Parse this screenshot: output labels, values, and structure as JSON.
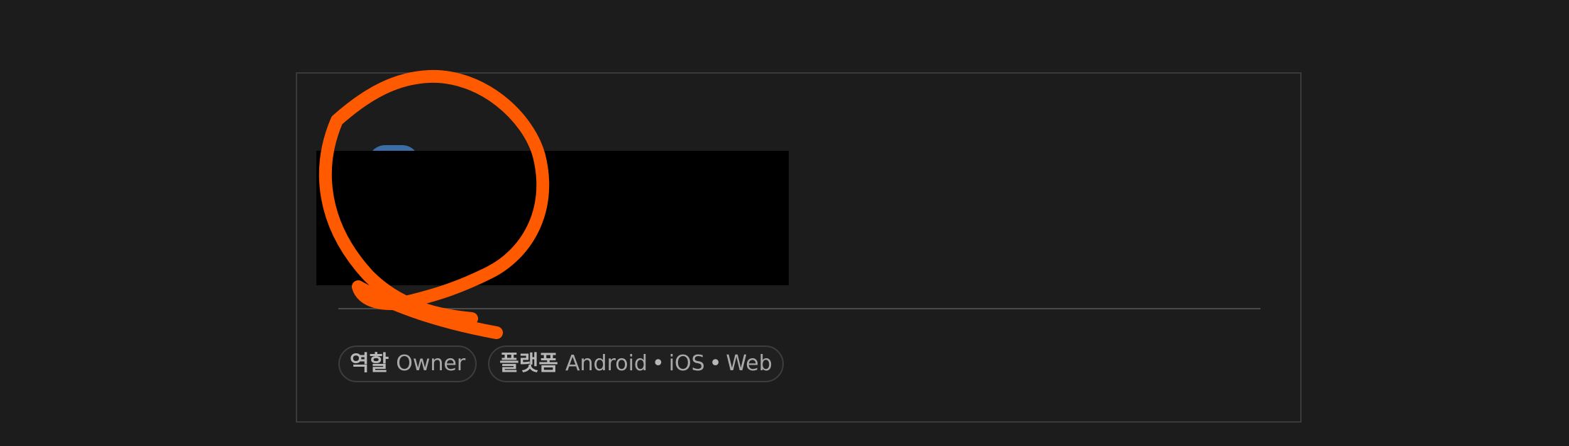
{
  "chips": {
    "role": {
      "label": "역할",
      "value": "Owner"
    },
    "platform": {
      "label": "플랫폼",
      "items": [
        "Android",
        "iOS",
        "Web"
      ],
      "separator": "•"
    }
  },
  "annotation": {
    "color": "#ff5a00"
  }
}
